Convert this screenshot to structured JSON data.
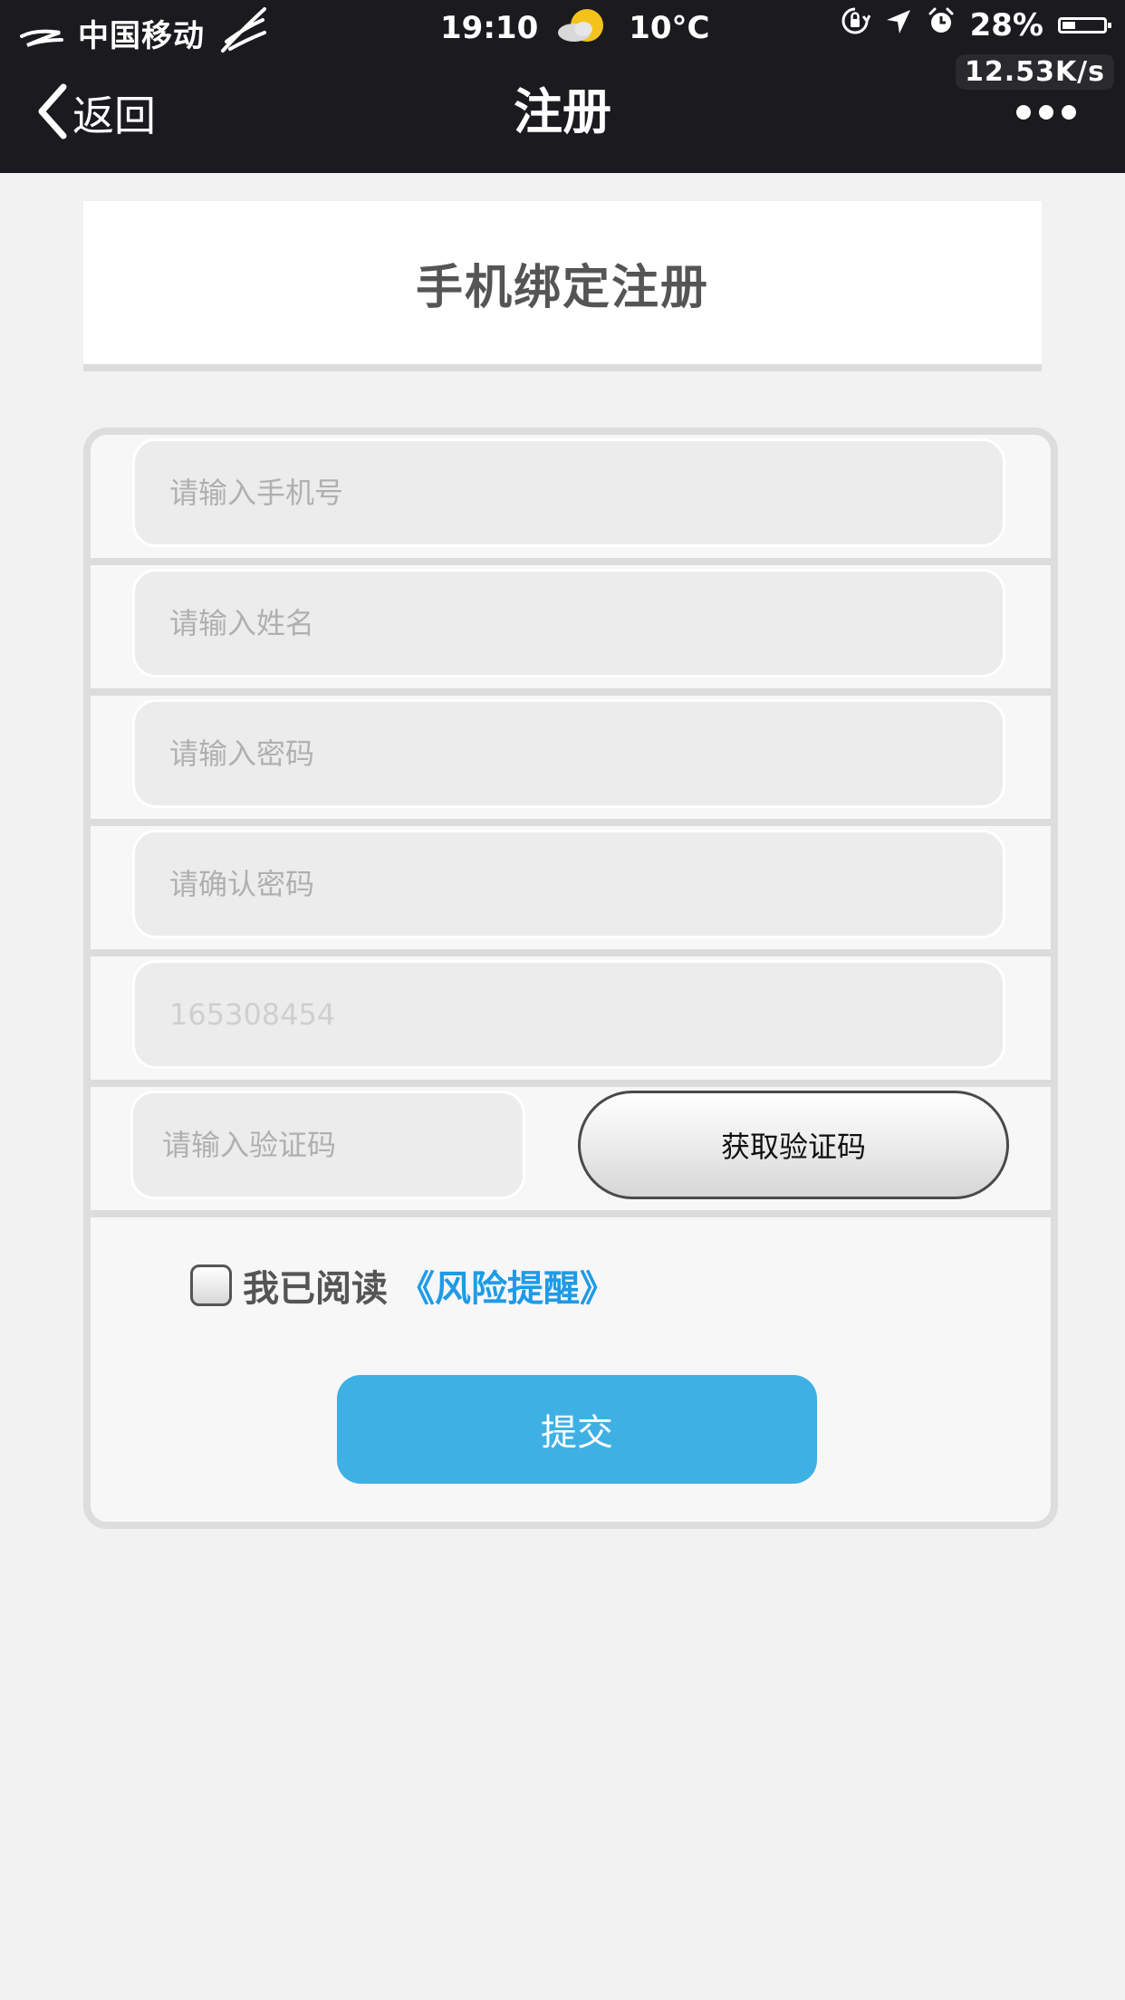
{
  "status_bar": {
    "carrier": "中国移动",
    "time": "19:10",
    "temperature": "10°C",
    "battery": "28%",
    "net_speed": "12.53K/s"
  },
  "nav": {
    "back_label": "返回",
    "title": "注册"
  },
  "heading": "手机绑定注册",
  "form": {
    "phone_placeholder": "请输入手机号",
    "name_placeholder": "请输入姓名",
    "password_placeholder": "请输入密码",
    "confirm_password_placeholder": "请确认密码",
    "prefill_value": "165308454",
    "code_placeholder": "请输入验证码",
    "get_code_label": "获取验证码",
    "agree_text": "我已阅读",
    "risk_link": "《风险提醒》",
    "submit_label": "提交"
  },
  "colors": {
    "header_bg": "#1b1b1f",
    "page_bg": "#f2f2f2",
    "submit_bg": "#3fb0e4",
    "link": "#1e9be6"
  },
  "icons": {
    "back": "chevron-left-icon",
    "more": "more-dots-icon",
    "weather": "partly-cloudy-icon",
    "carrier": "carrier-wing-icon",
    "rotation_lock": "rotation-lock-icon",
    "location": "location-arrow-icon",
    "alarm": "alarm-clock-icon",
    "battery": "battery-icon"
  }
}
